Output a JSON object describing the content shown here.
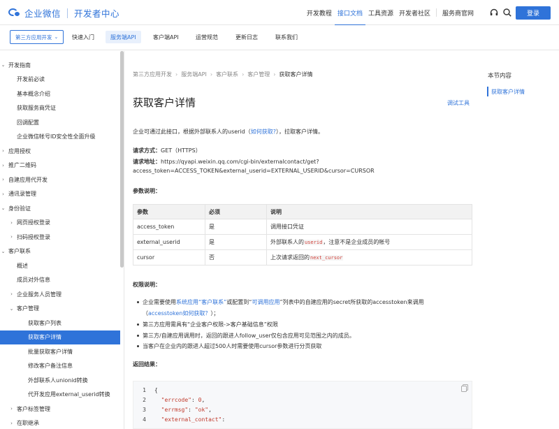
{
  "header": {
    "brand": "企业微信",
    "sub_brand": "开发者中心",
    "nav": [
      "开发教程",
      "接口文档",
      "工具资源",
      "开发者社区",
      "服务商官网"
    ],
    "active_nav": "接口文档",
    "login_label": "登录",
    "icons": [
      "headset-icon",
      "search-icon"
    ]
  },
  "subnav": {
    "select_label": "第三方应用开发",
    "tabs": [
      "快速入门",
      "服务端API",
      "客户端API",
      "运营规范",
      "更新日志",
      "联系我们"
    ],
    "active_tab": "服务端API"
  },
  "sidebar": {
    "items": [
      {
        "label": "开发指南",
        "caret": "v"
      },
      {
        "label": "开发前必读",
        "caret": ""
      },
      {
        "label": "基本概念介绍",
        "caret": ""
      },
      {
        "label": "获取服务商凭证",
        "caret": ""
      },
      {
        "label": "回调配置",
        "caret": ""
      },
      {
        "label": "企业微信帐号ID安全性全面升级",
        "caret": ""
      },
      {
        "label": "应用授权",
        "caret": ">"
      },
      {
        "label": "推广二维码",
        "caret": ">"
      },
      {
        "label": "自建应用代开发",
        "caret": ">"
      },
      {
        "label": "通讯录管理",
        "caret": ">"
      },
      {
        "label": "身份验证",
        "caret": "v"
      },
      {
        "label": "网页授权登录",
        "caret": ">"
      },
      {
        "label": "扫码授权登录",
        "caret": ">"
      },
      {
        "label": "客户联系",
        "caret": "v"
      },
      {
        "label": "概述",
        "caret": ""
      },
      {
        "label": "成员对外信息",
        "caret": ""
      },
      {
        "label": "企业服务人员管理",
        "caret": ">"
      },
      {
        "label": "客户管理",
        "caret": "v"
      },
      {
        "label": "获取客户列表",
        "caret": ""
      },
      {
        "label": "获取客户详情",
        "caret": ""
      },
      {
        "label": "批量获取客户详情",
        "caret": ""
      },
      {
        "label": "修改客户备注信息",
        "caret": ""
      },
      {
        "label": "外部联系人unionid转换",
        "caret": ""
      },
      {
        "label": "代开发应用external_userid转换",
        "caret": ""
      },
      {
        "label": "客户标签管理",
        "caret": ">"
      },
      {
        "label": "在职继承",
        "caret": ">"
      }
    ],
    "active_index": 19
  },
  "breadcrumb": [
    "第三方应用开发",
    "服务端API",
    "客户联系",
    "客户管理",
    "获取客户详情"
  ],
  "main": {
    "title": "获取客户详情",
    "debug_tool": "调试工具",
    "intro_before": "企业可通过此接口，根据外部联系人的userid（",
    "intro_link": "如何获取?",
    "intro_after": "），拉取客户详情。",
    "method_label": "请求方式：",
    "method_value": "GET（HTTPS）",
    "url_label": "请求地址：",
    "url_line1": "https://qyapi.weixin.qq.com/cgi-bin/externalcontact/get?",
    "url_line2": "access_token=ACCESS_TOKEN&external_userid=EXTERNAL_USERID&cursor=CURSOR",
    "params_heading": "参数说明：",
    "table_headers": [
      "参数",
      "必须",
      "说明"
    ],
    "table_rows": [
      {
        "name": "access_token",
        "required": "是",
        "desc": "调用接口凭证",
        "code": "",
        "desc_after": ""
      },
      {
        "name": "external_userid",
        "required": "是",
        "desc": "外部联系人的",
        "code": "userid",
        "desc_after": "，注意不是企业成员的帐号"
      },
      {
        "name": "cursor",
        "required": "否",
        "desc": "上次请求返回的",
        "code": "next_cursor",
        "desc_after": ""
      }
    ],
    "perm_heading": "权限说明：",
    "perm_b1_a": "企业需要使用",
    "perm_b1_link1": "系统应用“客户联系”",
    "perm_b1_b": "或配置到“",
    "perm_b1_link2": "可调用应用",
    "perm_b1_c": "”列表中的自建应用的secret所获取的accesstoken来调用",
    "perm_b1_d": "（",
    "perm_b1_link3": "accesstoken如何获取？",
    "perm_b1_e": "）；",
    "perm_b2": "第三方应用需具有“企业客户权限->客户基础信息”权限",
    "perm_b3": "第三方/自建应用调用时，返回的跟进人follow_user仅包含应用可见范围之内的成员。",
    "perm_b4": "当客户在企业内的跟进人超过500人时需要使用cursor参数进行分页获取",
    "return_heading": "返回结果：",
    "code_lines": [
      {
        "n": "1",
        "text": "{"
      },
      {
        "n": "2",
        "key": "\"errcode\"",
        "rest": ": ",
        "val": "0",
        "tail": ","
      },
      {
        "n": "3",
        "key": "\"errmsg\"",
        "rest": ": ",
        "val": "\"ok\"",
        "tail": ","
      },
      {
        "n": "4",
        "key": "\"external_contact\"",
        "rest": ":",
        "val": "",
        "tail": ""
      }
    ]
  },
  "toc": {
    "title": "本节内容",
    "items": [
      "获取客户详情"
    ]
  },
  "colors": {
    "accent": "#2f73d9",
    "code_red": "#d0413a"
  }
}
